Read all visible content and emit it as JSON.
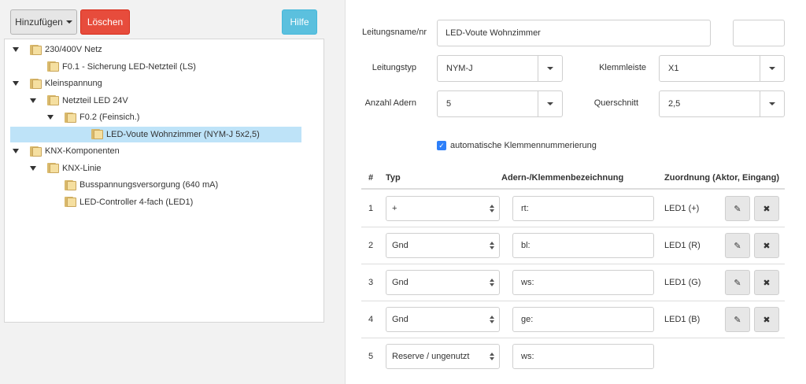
{
  "toolbar": {
    "add_label": "Hinzufügen",
    "delete_label": "Löschen",
    "help_label": "Hilfe"
  },
  "tree": [
    {
      "label": "230/400V Netz",
      "level": 0,
      "toggle": true,
      "selected": false
    },
    {
      "label": "F0.1 - Sicherung LED-Netzteil (LS)",
      "level": 1,
      "toggle": false,
      "selected": false
    },
    {
      "label": "Kleinspannung",
      "level": 0,
      "toggle": true,
      "selected": false
    },
    {
      "label": "Netzteil LED 24V",
      "level": 1,
      "toggle": true,
      "selected": false
    },
    {
      "label": "F0.2 (Feinsich.)",
      "level": 2,
      "toggle": true,
      "selected": false
    },
    {
      "label": "LED-Voute Wohnzimmer (NYM-J 5x2,5)",
      "level": 3,
      "toggle": false,
      "selected": true
    },
    {
      "label": "KNX-Komponenten",
      "level": 0,
      "toggle": true,
      "selected": false
    },
    {
      "label": "KNX-Linie",
      "level": 1,
      "toggle": true,
      "selected": false
    },
    {
      "label": "Busspannungsversorgung (640 mA)",
      "level": 2,
      "toggle": false,
      "selected": false
    },
    {
      "label": "LED-Controller 4-fach (LED1)",
      "level": 2,
      "toggle": false,
      "selected": false
    }
  ],
  "form": {
    "leitungsname_label": "Leitungsname/nr",
    "leitungsname_value": "LED-Voute Wohnzimmer",
    "extra_value": "",
    "leitungstyp_label": "Leitungstyp",
    "leitungstyp_value": "NYM-J",
    "klemmleiste_label": "Klemmleiste",
    "klemmleiste_value": "X1",
    "adern_label": "Anzahl Adern",
    "adern_value": "5",
    "querschnitt_label": "Querschnitt",
    "querschnitt_value": "2,5",
    "auto_label": "automatische Klemmennummerierung",
    "auto_checked": true
  },
  "table": {
    "headers": {
      "num": "#",
      "typ": "Typ",
      "adern": "Adern-/Klemmenbezeichnung",
      "zuordnung": "Zuordnung (Aktor, Eingang)"
    },
    "rows": [
      {
        "num": "1",
        "typ": "+",
        "bez": "rt:",
        "zuordnung": "LED1 (+)",
        "actions": true
      },
      {
        "num": "2",
        "typ": "Gnd",
        "bez": "bl:",
        "zuordnung": "LED1 (R)",
        "actions": true
      },
      {
        "num": "3",
        "typ": "Gnd",
        "bez": "ws:",
        "zuordnung": "LED1 (G)",
        "actions": true
      },
      {
        "num": "4",
        "typ": "Gnd",
        "bez": "ge:",
        "zuordnung": "LED1 (B)",
        "actions": true
      },
      {
        "num": "5",
        "typ": "Reserve / ungenutzt",
        "bez": "ws:",
        "zuordnung": "",
        "actions": false
      }
    ],
    "edit_icon": "pencil-icon",
    "delete_icon": "times-icon"
  }
}
